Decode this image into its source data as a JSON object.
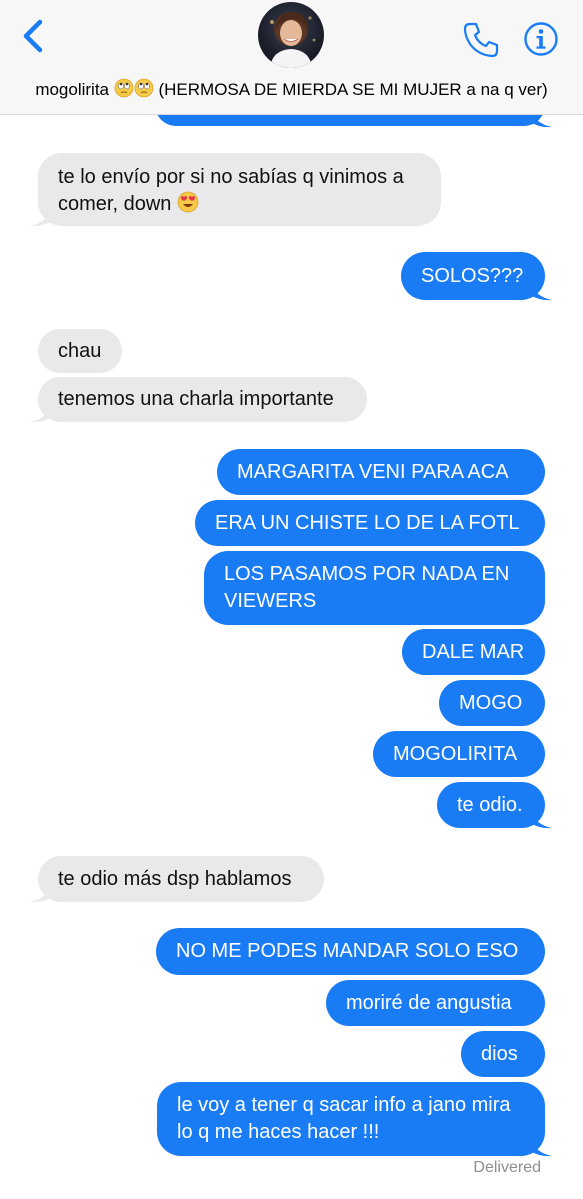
{
  "header": {
    "contact_name": "mogolirita",
    "contact_name_suffix": "(HERMOSA DE MIERDA SE MI MUJER a na q ver)",
    "name_emojis": "rolling-eyes-emoji rolling-eyes-emoji",
    "icons": {
      "back": "chevron-left-icon",
      "phone": "phone-icon",
      "info": "info-icon"
    },
    "accent_color": "#1a7cf5"
  },
  "colors": {
    "outgoing": "#1a7cf5",
    "incoming": "#e9e9eb"
  },
  "messages": [
    {
      "direction": "in",
      "text": "te lo envío por si no sabías q vinimos a comer, down",
      "emoji": "heart-eyes-emoji"
    },
    {
      "direction": "out",
      "text": "SOLOS???"
    },
    {
      "direction": "in",
      "text": "chau"
    },
    {
      "direction": "in",
      "text": "tenemos una charla importante"
    },
    {
      "direction": "out",
      "text": "MARGARITA VENI PARA ACA"
    },
    {
      "direction": "out",
      "text": "ERA UN CHISTE LO DE LA FOTL"
    },
    {
      "direction": "out",
      "text": "LOS PASAMOS POR NADA EN VIEWERS"
    },
    {
      "direction": "out",
      "text": "DALE MAR"
    },
    {
      "direction": "out",
      "text": "MOGO"
    },
    {
      "direction": "out",
      "text": "MOGOLIRITA"
    },
    {
      "direction": "out",
      "text": "te odio."
    },
    {
      "direction": "in",
      "text": "te odio más dsp hablamos"
    },
    {
      "direction": "out",
      "text": "NO ME PODES MANDAR SOLO ESO"
    },
    {
      "direction": "out",
      "text": "moriré de angustia"
    },
    {
      "direction": "out",
      "text": "dios"
    },
    {
      "direction": "out",
      "text": "le voy a tener q sacar info a jano mira lo q me haces hacer !!!"
    }
  ],
  "status": "Delivered"
}
